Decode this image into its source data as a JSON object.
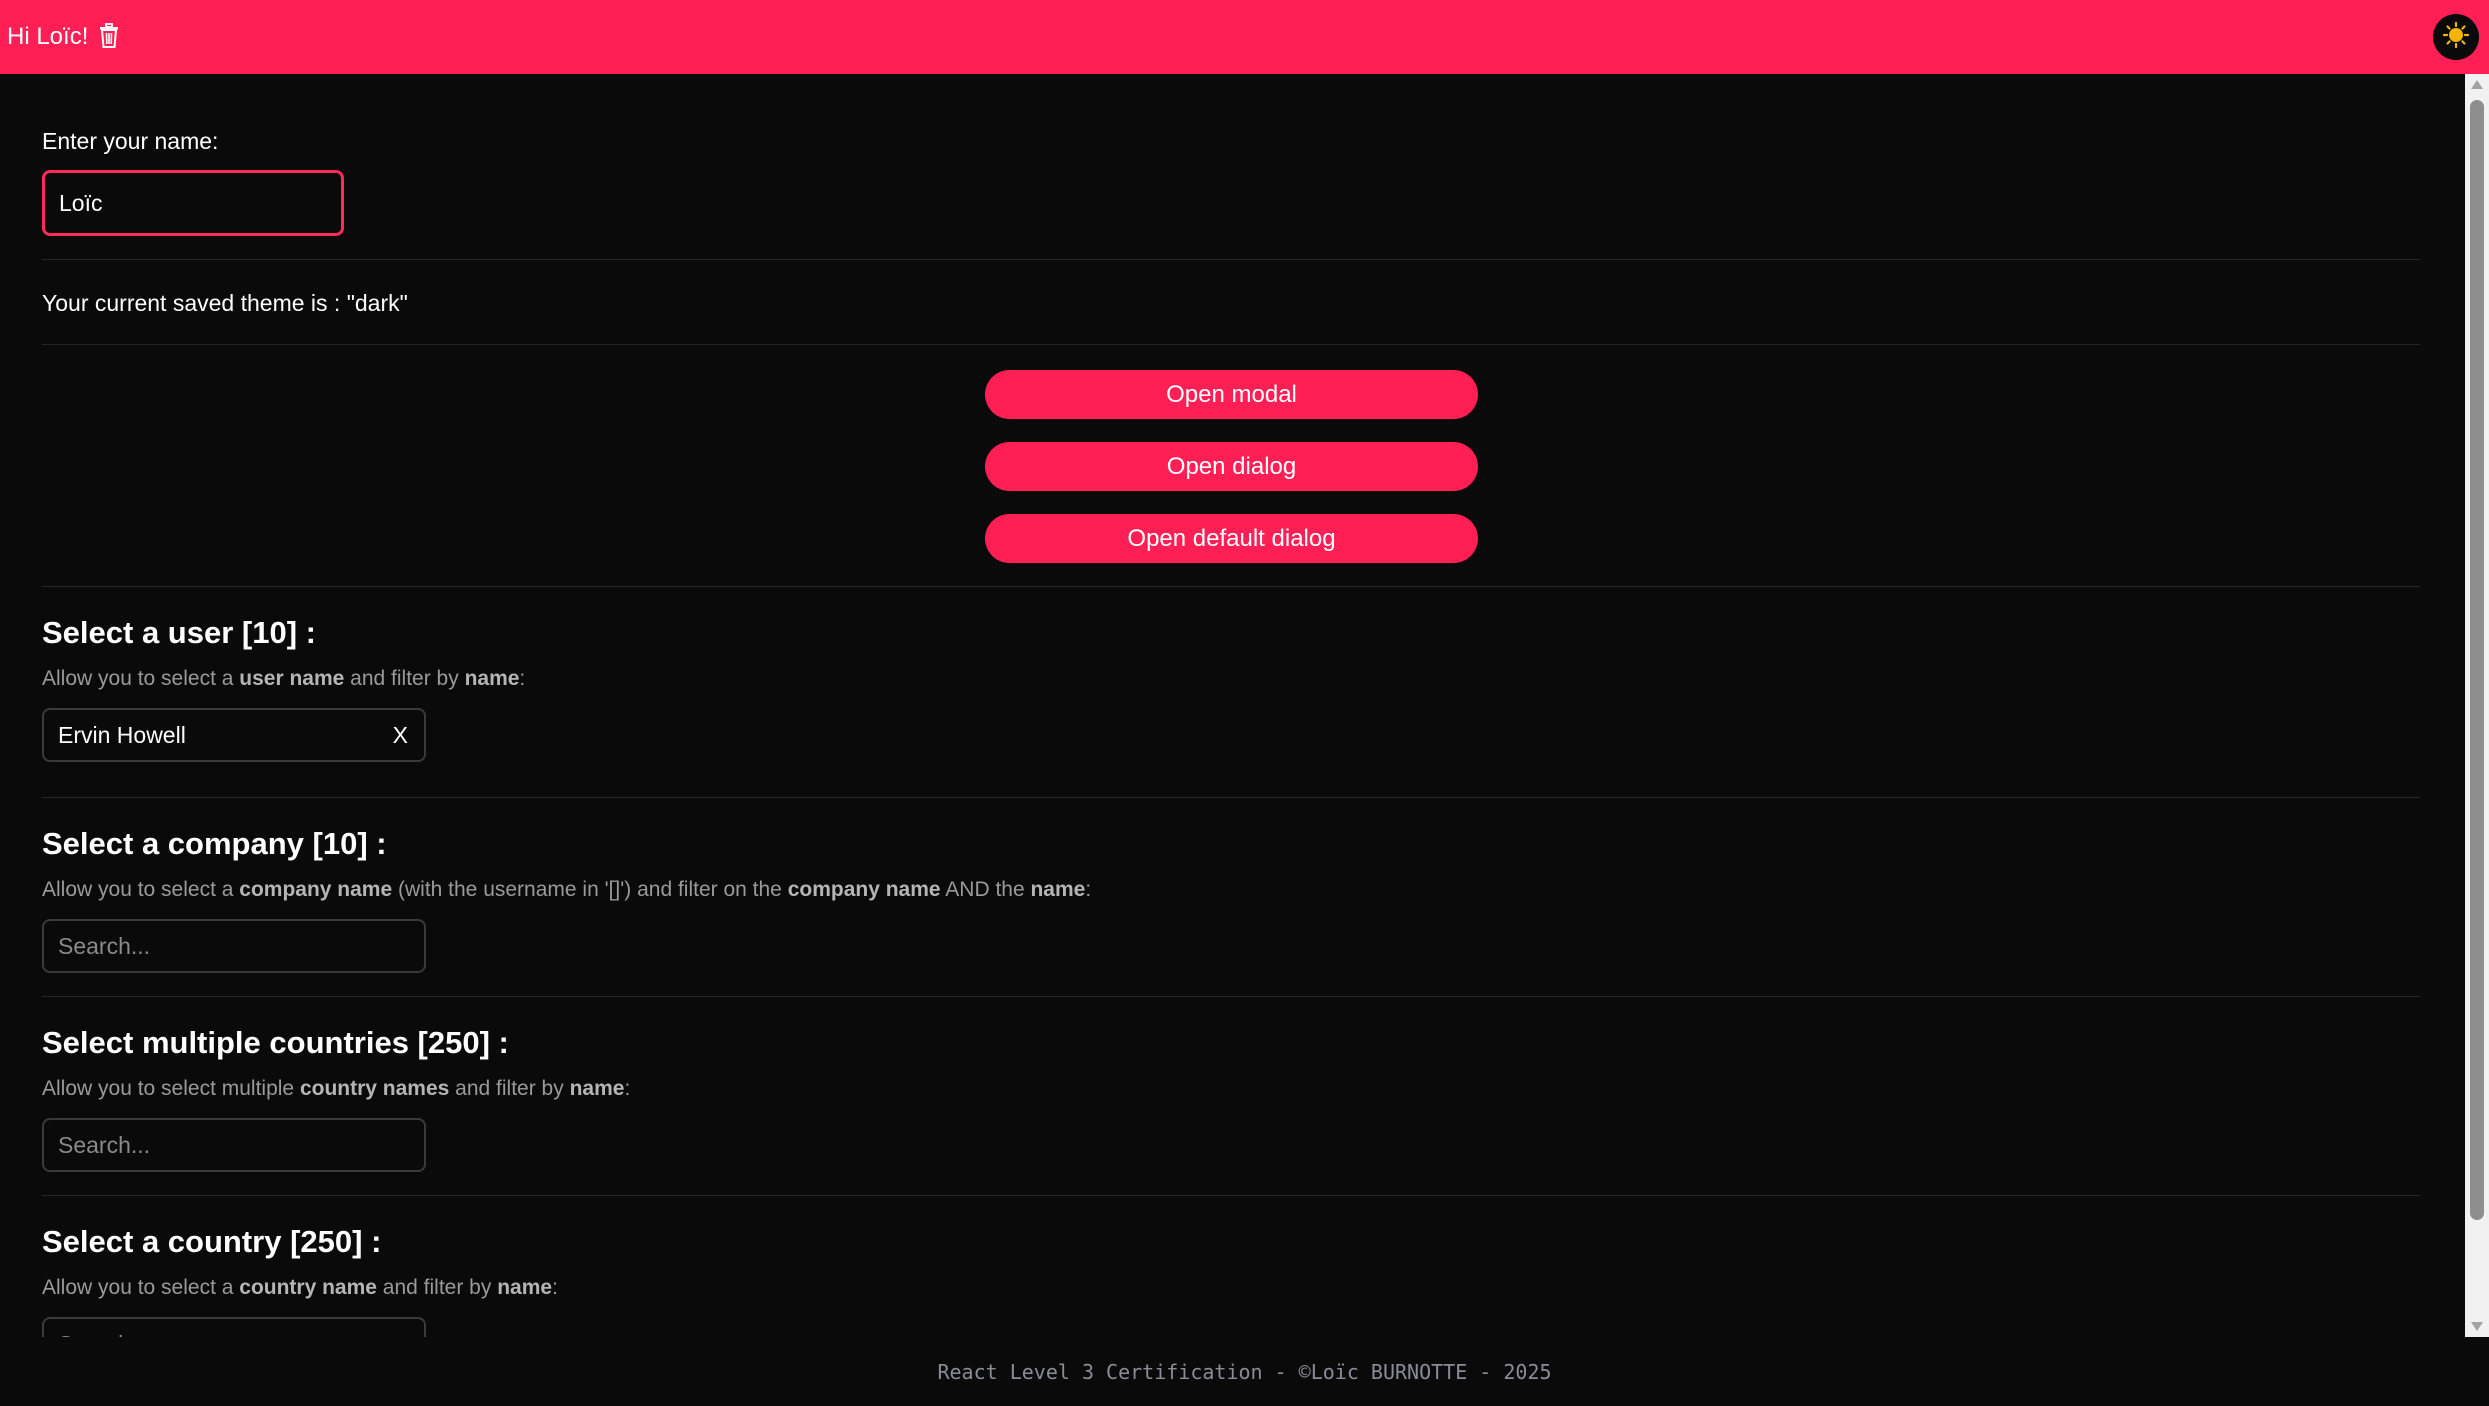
{
  "header": {
    "greeting": "Hi Loïc!",
    "trash_icon": "trash-icon",
    "theme_icon": "sun-icon",
    "background": "#ff1f55"
  },
  "name_section": {
    "label": "Enter your name:",
    "value": "Loïc"
  },
  "theme_section": {
    "text": "Your current saved theme is : \"dark\""
  },
  "buttons": {
    "open_modal": "Open modal",
    "open_dialog": "Open dialog",
    "open_default_dialog": "Open default dialog"
  },
  "user_select": {
    "title": "Select a user [10] :",
    "desc_prefix": "Allow you to select a ",
    "desc_bold1": "user name",
    "desc_mid": " and filter by ",
    "desc_bold2": "name",
    "desc_suffix": ":",
    "value": "Ervin Howell",
    "clear_label": "X"
  },
  "company_select": {
    "title": "Select a company [10] :",
    "desc_prefix": "Allow you to select a ",
    "desc_bold1": "company name",
    "desc_mid1": " (with the username in '[]') and filter on the ",
    "desc_bold2": "company name",
    "desc_mid2": " AND the ",
    "desc_bold3": "name",
    "desc_suffix": ":",
    "placeholder": "Search..."
  },
  "multi_country_select": {
    "title": "Select multiple countries [250] :",
    "desc_prefix": "Allow you to select multiple ",
    "desc_bold1": "country names",
    "desc_mid": " and filter by ",
    "desc_bold2": "name",
    "desc_suffix": ":",
    "placeholder": "Search..."
  },
  "country_select": {
    "title": "Select a country [250] :",
    "desc_prefix": "Allow you to select a ",
    "desc_bold1": "country name",
    "desc_mid": " and filter by ",
    "desc_bold2": "name",
    "desc_suffix": ":",
    "placeholder": "Search..."
  },
  "footer": {
    "text": "React Level 3 Certification - ©Loïc BURNOTTE - 2025"
  },
  "colors": {
    "accent": "#ff1f55",
    "background": "#0a0a0a",
    "divider": "#262626"
  }
}
